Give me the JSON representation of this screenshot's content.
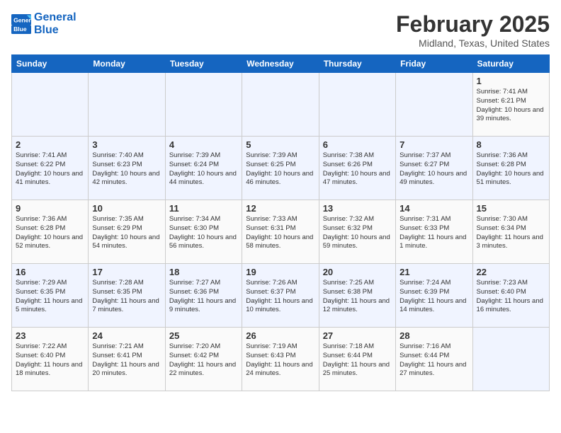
{
  "header": {
    "logo_line1": "General",
    "logo_line2": "Blue",
    "title": "February 2025",
    "subtitle": "Midland, Texas, United States"
  },
  "days_of_week": [
    "Sunday",
    "Monday",
    "Tuesday",
    "Wednesday",
    "Thursday",
    "Friday",
    "Saturday"
  ],
  "weeks": [
    [
      {
        "day": "",
        "text": ""
      },
      {
        "day": "",
        "text": ""
      },
      {
        "day": "",
        "text": ""
      },
      {
        "day": "",
        "text": ""
      },
      {
        "day": "",
        "text": ""
      },
      {
        "day": "",
        "text": ""
      },
      {
        "day": "1",
        "text": "Sunrise: 7:41 AM\nSunset: 6:21 PM\nDaylight: 10 hours and 39 minutes."
      }
    ],
    [
      {
        "day": "2",
        "text": "Sunrise: 7:41 AM\nSunset: 6:22 PM\nDaylight: 10 hours and 41 minutes."
      },
      {
        "day": "3",
        "text": "Sunrise: 7:40 AM\nSunset: 6:23 PM\nDaylight: 10 hours and 42 minutes."
      },
      {
        "day": "4",
        "text": "Sunrise: 7:39 AM\nSunset: 6:24 PM\nDaylight: 10 hours and 44 minutes."
      },
      {
        "day": "5",
        "text": "Sunrise: 7:39 AM\nSunset: 6:25 PM\nDaylight: 10 hours and 46 minutes."
      },
      {
        "day": "6",
        "text": "Sunrise: 7:38 AM\nSunset: 6:26 PM\nDaylight: 10 hours and 47 minutes."
      },
      {
        "day": "7",
        "text": "Sunrise: 7:37 AM\nSunset: 6:27 PM\nDaylight: 10 hours and 49 minutes."
      },
      {
        "day": "8",
        "text": "Sunrise: 7:36 AM\nSunset: 6:28 PM\nDaylight: 10 hours and 51 minutes."
      }
    ],
    [
      {
        "day": "9",
        "text": "Sunrise: 7:36 AM\nSunset: 6:28 PM\nDaylight: 10 hours and 52 minutes."
      },
      {
        "day": "10",
        "text": "Sunrise: 7:35 AM\nSunset: 6:29 PM\nDaylight: 10 hours and 54 minutes."
      },
      {
        "day": "11",
        "text": "Sunrise: 7:34 AM\nSunset: 6:30 PM\nDaylight: 10 hours and 56 minutes."
      },
      {
        "day": "12",
        "text": "Sunrise: 7:33 AM\nSunset: 6:31 PM\nDaylight: 10 hours and 58 minutes."
      },
      {
        "day": "13",
        "text": "Sunrise: 7:32 AM\nSunset: 6:32 PM\nDaylight: 10 hours and 59 minutes."
      },
      {
        "day": "14",
        "text": "Sunrise: 7:31 AM\nSunset: 6:33 PM\nDaylight: 11 hours and 1 minute."
      },
      {
        "day": "15",
        "text": "Sunrise: 7:30 AM\nSunset: 6:34 PM\nDaylight: 11 hours and 3 minutes."
      }
    ],
    [
      {
        "day": "16",
        "text": "Sunrise: 7:29 AM\nSunset: 6:35 PM\nDaylight: 11 hours and 5 minutes."
      },
      {
        "day": "17",
        "text": "Sunrise: 7:28 AM\nSunset: 6:35 PM\nDaylight: 11 hours and 7 minutes."
      },
      {
        "day": "18",
        "text": "Sunrise: 7:27 AM\nSunset: 6:36 PM\nDaylight: 11 hours and 9 minutes."
      },
      {
        "day": "19",
        "text": "Sunrise: 7:26 AM\nSunset: 6:37 PM\nDaylight: 11 hours and 10 minutes."
      },
      {
        "day": "20",
        "text": "Sunrise: 7:25 AM\nSunset: 6:38 PM\nDaylight: 11 hours and 12 minutes."
      },
      {
        "day": "21",
        "text": "Sunrise: 7:24 AM\nSunset: 6:39 PM\nDaylight: 11 hours and 14 minutes."
      },
      {
        "day": "22",
        "text": "Sunrise: 7:23 AM\nSunset: 6:40 PM\nDaylight: 11 hours and 16 minutes."
      }
    ],
    [
      {
        "day": "23",
        "text": "Sunrise: 7:22 AM\nSunset: 6:40 PM\nDaylight: 11 hours and 18 minutes."
      },
      {
        "day": "24",
        "text": "Sunrise: 7:21 AM\nSunset: 6:41 PM\nDaylight: 11 hours and 20 minutes."
      },
      {
        "day": "25",
        "text": "Sunrise: 7:20 AM\nSunset: 6:42 PM\nDaylight: 11 hours and 22 minutes."
      },
      {
        "day": "26",
        "text": "Sunrise: 7:19 AM\nSunset: 6:43 PM\nDaylight: 11 hours and 24 minutes."
      },
      {
        "day": "27",
        "text": "Sunrise: 7:18 AM\nSunset: 6:44 PM\nDaylight: 11 hours and 25 minutes."
      },
      {
        "day": "28",
        "text": "Sunrise: 7:16 AM\nSunset: 6:44 PM\nDaylight: 11 hours and 27 minutes."
      },
      {
        "day": "",
        "text": ""
      }
    ]
  ]
}
